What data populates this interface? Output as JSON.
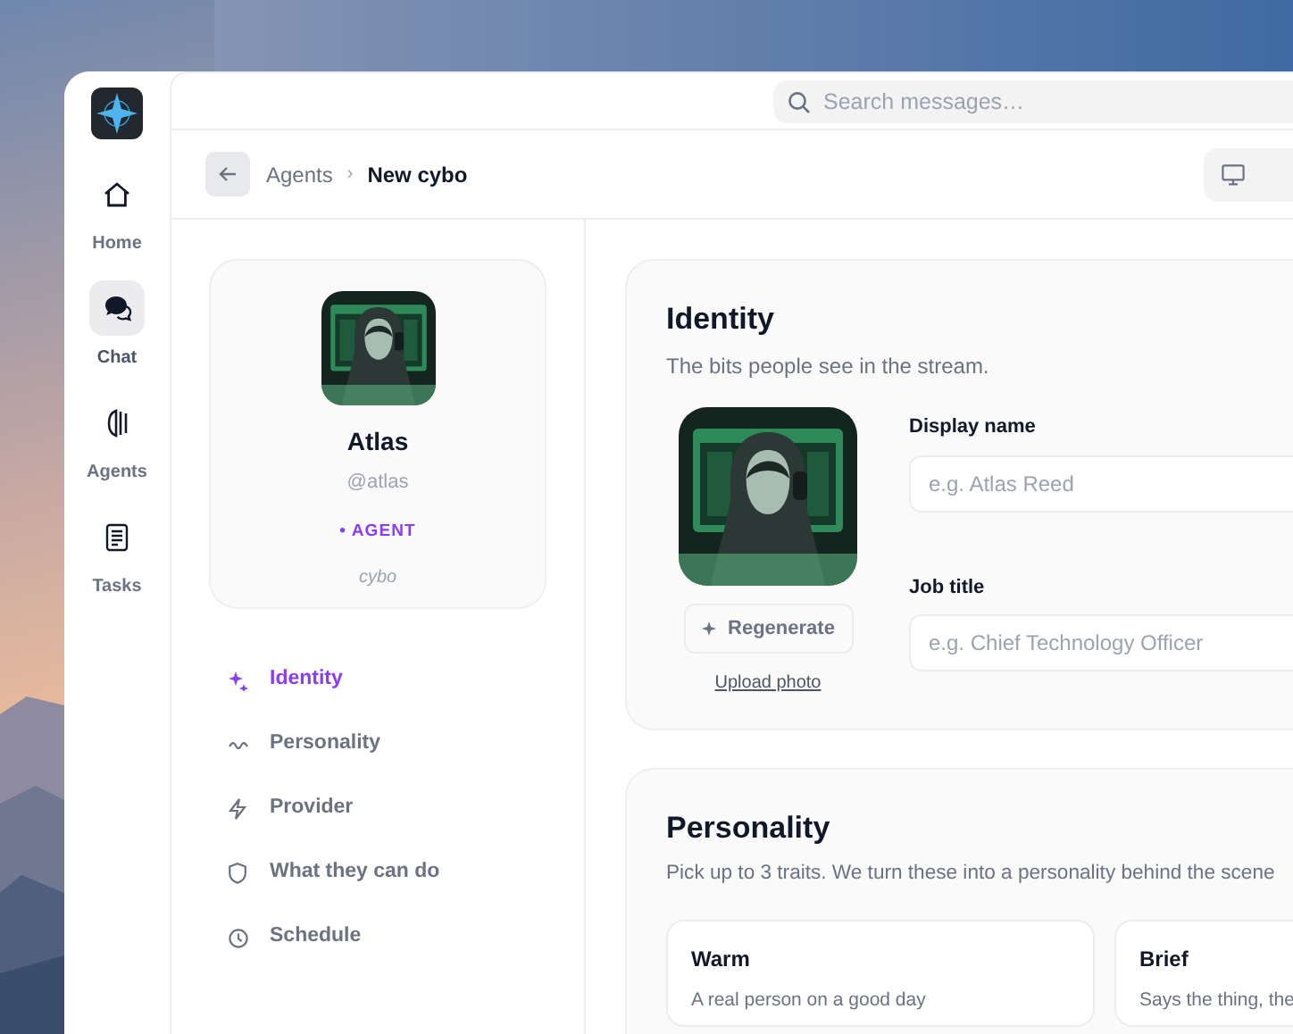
{
  "rail": {
    "items": [
      {
        "label": "Home",
        "selected": false
      },
      {
        "label": "Chat",
        "selected": true
      },
      {
        "label": "Agents",
        "selected": false
      },
      {
        "label": "Tasks",
        "selected": false
      }
    ]
  },
  "search": {
    "placeholder": "Search messages…"
  },
  "breadcrumb": {
    "parent": "Agents",
    "separator": "›",
    "current": "New cybo"
  },
  "profile": {
    "name": "Atlas",
    "handle": "@atlas",
    "tag": "• AGENT",
    "subtitle": "cybo"
  },
  "section_nav": [
    {
      "label": "Identity",
      "selected": true
    },
    {
      "label": "Personality",
      "selected": false
    },
    {
      "label": "Provider",
      "selected": false
    },
    {
      "label": "What they can do",
      "selected": false
    },
    {
      "label": "Schedule",
      "selected": false
    }
  ],
  "identity": {
    "title": "Identity",
    "description": "The bits people see in the stream.",
    "regenerate_button": "Regenerate",
    "upload_link": "Upload photo",
    "fields": [
      {
        "label": "Display name",
        "placeholder": "e.g. Atlas Reed"
      },
      {
        "label": "Job title",
        "placeholder": "e.g. Chief Technology Officer"
      }
    ]
  },
  "personality": {
    "title": "Personality",
    "description": "Pick up to 3 traits. We turn these into a personality behind the scene",
    "traits": [
      {
        "name": "Warm",
        "description": "A real person on a good day",
        "selected": false
      },
      {
        "name": "Brief",
        "description": "Says the thing, the",
        "selected": false
      }
    ]
  }
}
